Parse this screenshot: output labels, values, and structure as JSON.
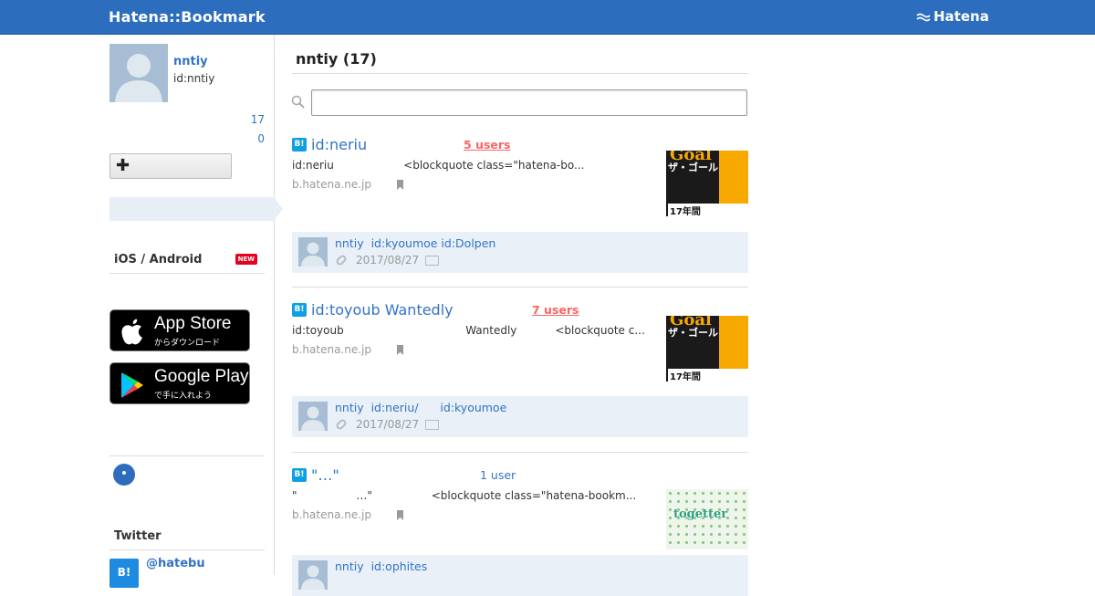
{
  "header": {
    "logo": "Hatena::Bookmark",
    "brand": "Hatena"
  },
  "profile": {
    "name": "nntiy",
    "id": "id:nntiy",
    "count_a": "17",
    "count_b": "0",
    "follow_label": "✚"
  },
  "sidebar": {
    "apps_heading": "iOS / Android",
    "new_badge": "NEW",
    "app_store": {
      "big": "App Store",
      "small": "からダウンロード"
    },
    "google_play": {
      "big": "Google Play",
      "small": "で手に入れよう"
    },
    "twitter_heading": "Twitter",
    "twitter_avatar": "B!",
    "twitter_handle": "@hatebu"
  },
  "main": {
    "page_title": "nntiy (17)",
    "search_placeholder": "",
    "entries": [
      {
        "badge": "B!",
        "title": "id:neriu",
        "users": "5 users",
        "desc": "id:neriu                    <blockquote class=\"hatena-bo...",
        "domain": "b.hatena.ne.jp",
        "thumb_text": [
          "ザ・ゴール",
          "17年間",
          "Goal"
        ],
        "comment_user": "nntiy  id:kyoumoe id:Dolpen",
        "comment_date": "2017/08/27"
      },
      {
        "badge": "B!",
        "title": "id:toyoub Wantedly",
        "users": "7 users",
        "desc": "id:toyoub                                   Wantedly           <blockquote c...",
        "domain": "b.hatena.ne.jp",
        "thumb_text": [
          "ザ・ゴール",
          "17年間",
          "Goal"
        ],
        "comment_user": "nntiy  id:neriu/      id:kyoumoe",
        "comment_date": "2017/08/27"
      },
      {
        "badge": "B!",
        "title": "\"…\"",
        "users": "1 user",
        "desc": "\"                 …\"                 <blockquote class=\"hatena-bookm...",
        "domain": "b.hatena.ne.jp",
        "thumb_text": [
          "togetter"
        ],
        "comment_user": "nntiy  id:ophites"
      }
    ]
  }
}
